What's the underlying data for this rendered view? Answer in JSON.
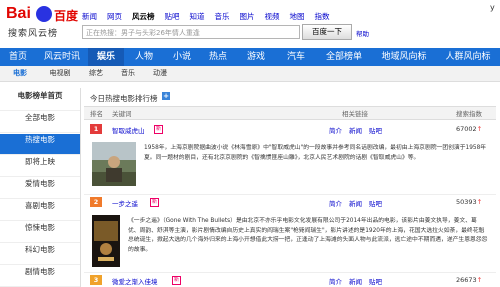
{
  "header": {
    "logo_text": "Bai",
    "logo_du": "百度",
    "logo_sub": "搜索风云榜",
    "corner": "y",
    "topnav": [
      "新闻",
      "网页",
      "风云榜",
      "贴吧",
      "知道",
      "音乐",
      "图片",
      "视频",
      "地图",
      "指数"
    ],
    "topnav_current": 2,
    "search_placeholder": "正在热搜：男子与头彩26年情人重逢",
    "search_button": "百度一下",
    "help_link": "帮助"
  },
  "bluenav": [
    "首页",
    "风云时讯",
    "娱乐",
    "人物",
    "小说",
    "热点",
    "游戏",
    "汽车",
    "全部榜单",
    "地域风向标",
    "人群风向标"
  ],
  "bluenav_current": 2,
  "subnav": [
    "电影",
    "电视剧",
    "综艺",
    "音乐",
    "动漫"
  ],
  "subnav_current": 0,
  "sidebar": {
    "heading": "电影榜单首页",
    "items": [
      "全部电影",
      "热搜电影",
      "即将上映",
      "爱情电影",
      "喜剧电影",
      "惊悚电影",
      "科幻电影",
      "剧情电影"
    ],
    "active": 1
  },
  "panel": {
    "title": "今日热搜电影排行榜",
    "columns": {
      "rank": "排名",
      "keyword": "关键词",
      "related": "相关链接",
      "index": "搜索指数"
    }
  },
  "rows": [
    {
      "rank": "1",
      "title": "智取威虎山",
      "tag": "新",
      "links": [
        "简介",
        "新闻",
        "贴吧"
      ],
      "score": "67002",
      "trend": "↑",
      "desc": "1958年，上海京剧院据曲波小说《林海雪原》中\"智取威虎山\"的一段故事并参考同名话剧改编，最初由上海京剧院一团创演于1958年夏。同一题材的剧目，还有北京京剧院的《智擒惯匪座山雕》，北京人民艺术剧院的话剧《智取威虎山》等。"
    },
    {
      "rank": "2",
      "title": "一步之遥",
      "tag": "新",
      "links": [
        "简介",
        "新闻",
        "贴吧"
      ],
      "score": "50393",
      "trend": "↑",
      "desc": "《一步之遥》（Gone With The Bullets）是由北京不亦乐乎电影文化发展有限公司于2014年出品的电影，该影片由姜文执导，姜文、葛优、周韵、舒淇等主演，影片剧情改编自历史上真实的阎瑞生案\"枪毙阎瑞生\"，影片讲述的是1920年的上海，花国大选拉火如荼，最终花魁总统诞生，掀起大选的几个海外归来的上海小开想借此大捞一把，正逢动了上海滩的头面人物与此流派，逃亡途中不期而遇，遂产生恩恩怨怨的故事。"
    },
    {
      "rank": "3",
      "title": "微爱之渐入佳境",
      "tag": "新",
      "links": [
        "简介",
        "新闻",
        "贴吧"
      ],
      "score": "26673",
      "trend": "↑"
    }
  ],
  "colors": {
    "brand_blue": "#1a6fd5",
    "rank1": "#e33b3b",
    "rank2": "#f07a2b",
    "rank3": "#f0a22b",
    "link": "#0000cc"
  }
}
